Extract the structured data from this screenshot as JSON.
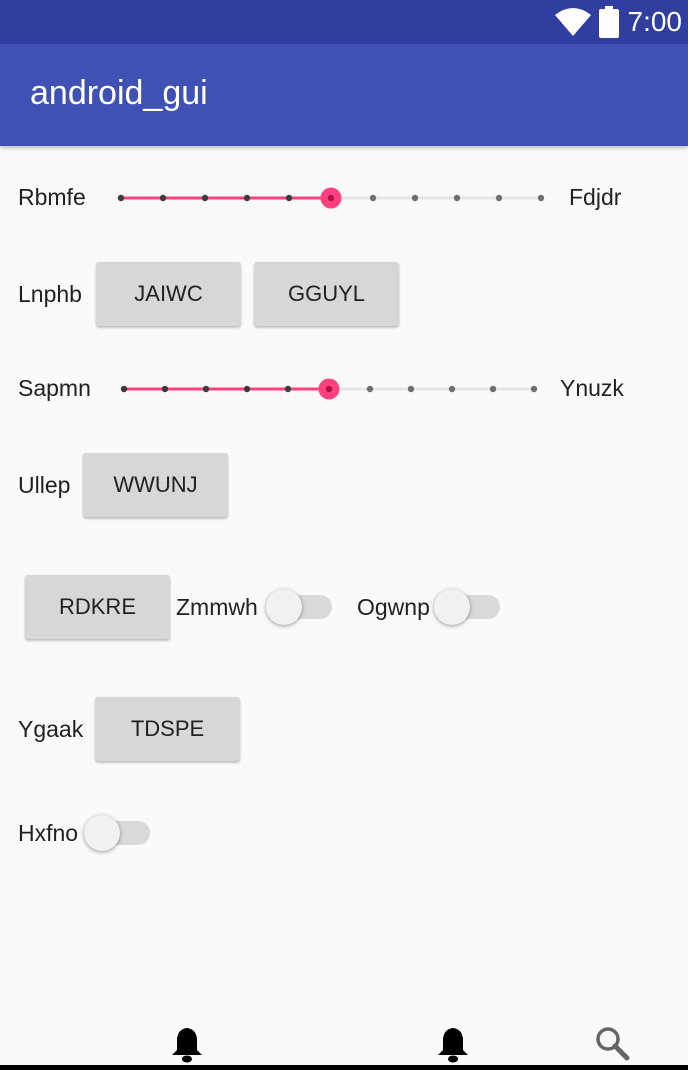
{
  "status_bar": {
    "time": "7:00",
    "icons": [
      "wifi-icon",
      "battery-icon"
    ]
  },
  "app_bar": {
    "title": "android_gui"
  },
  "row1": {
    "label_left": "Rbmfe",
    "label_right": "Fdjdr",
    "seek_level": 5,
    "seek_max": 10
  },
  "row2": {
    "label": "Lnphb",
    "button1": "JAIWC",
    "button2": "GGUYL"
  },
  "row3": {
    "label_left": "Sapmn",
    "label_right": "Ynuzk",
    "seek_level": 5,
    "seek_max": 10
  },
  "row4": {
    "label": "Ullep",
    "button": "WWUNJ"
  },
  "row5": {
    "button": "RDKRE",
    "switch1_label": "Zmmwh",
    "switch1_on": false,
    "switch2_label": "Ogwnp",
    "switch2_on": false
  },
  "row6": {
    "label": "Ygaak",
    "button": "TDSPE"
  },
  "row7": {
    "switch_label": "Hxfno",
    "switch_on": false
  },
  "bottom_nav": {
    "icons": [
      "bell-icon",
      "bell-icon",
      "search-icon"
    ]
  },
  "colors": {
    "accent": "#ff4081",
    "primary": "#3f51b5",
    "primary_dark": "#303f9f"
  }
}
